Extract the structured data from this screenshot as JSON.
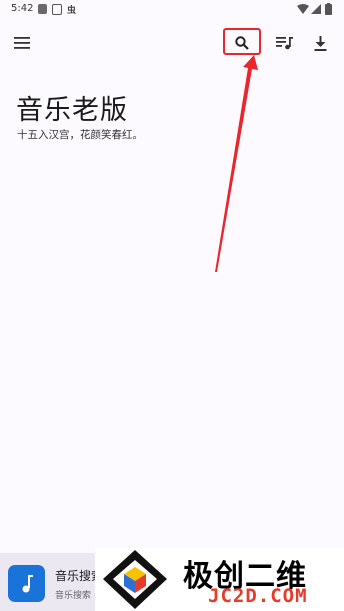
{
  "status_bar": {
    "time": "5:42",
    "icons": [
      "app-icon",
      "font-icon",
      "bug-icon",
      "wifi-icon",
      "signal-icon",
      "battery-icon"
    ]
  },
  "toolbar": {
    "icons": [
      "menu-icon",
      "search-icon",
      "queue-music-icon",
      "download-icon"
    ],
    "highlight_color": "#e8262b"
  },
  "main": {
    "title": "音乐老版",
    "subtitle": "十五入汉宫，花颜笑春红。"
  },
  "mini_player": {
    "title": "音乐搜索",
    "subtitle": "音乐搜索",
    "art_color": "#1a73d8"
  },
  "watermark": {
    "cn": "极创二维",
    "en": "JC2D.COM"
  },
  "colors": {
    "background": "#fcfafe",
    "annotation": "#e8262b"
  }
}
